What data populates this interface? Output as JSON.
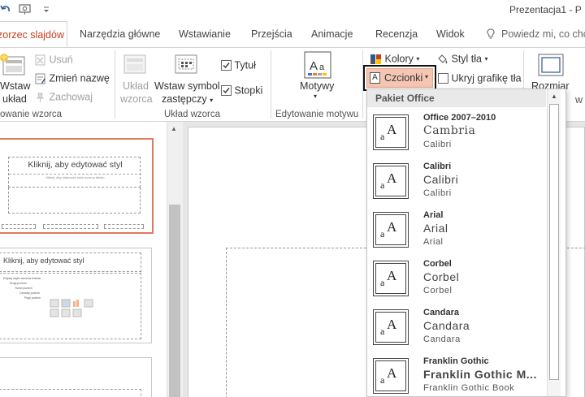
{
  "window": {
    "title": "Prezentacja1 - P"
  },
  "tabs": [
    {
      "label": "zorzec slajdów",
      "active": true
    },
    {
      "label": "Narzędzia główne"
    },
    {
      "label": "Wstawianie"
    },
    {
      "label": "Przejścia"
    },
    {
      "label": "Animacje"
    },
    {
      "label": "Recenzja"
    },
    {
      "label": "Widok"
    }
  ],
  "tell_me": {
    "placeholder": "Powiedz mi, co chc"
  },
  "ribbon": {
    "edit_master": {
      "insert_layout": [
        "Wstaw",
        "układ"
      ],
      "delete": "Usuń",
      "rename": "Zmień nazwę",
      "preserve": "Zachowaj",
      "group_label": "owanie wzorca"
    },
    "master_layout": {
      "layout": [
        "Układ",
        "wzorca"
      ],
      "insert_placeholder": [
        "Wstaw symbol",
        "zastępczy"
      ],
      "title_checkbox": "Tytuł",
      "footers_checkbox": "Stopki",
      "group_label": "Układ wzorca"
    },
    "edit_theme": {
      "themes": "Motywy",
      "group_label": "Edytowanie motywu"
    },
    "background": {
      "colors": "Kolory",
      "fonts": "Czcionki",
      "background_styles": "Styl tła",
      "hide_graphics": "Ukryj grafikę tła",
      "slide_size": "Rozmiar"
    }
  },
  "thumbnails": {
    "master_title": "Kliknij, aby edytować styl",
    "master_subtitle": "Kliknij, aby edytować style wzorca tekstu",
    "layout_title": "Kliknij, aby edytować styl",
    "layout_bullets": [
      "Edytuj style wzorca tekstu",
      "Drugi poziom",
      "Trzeci poziom",
      "Czwarty poziom",
      "Piąty poziom"
    ]
  },
  "fonts_dropdown": {
    "header": "Pakiet Office",
    "items": [
      {
        "name": "Office 2007–2010",
        "heading": "Cambria",
        "body": "Calibri"
      },
      {
        "name": "Calibri",
        "heading": "Calibri",
        "body": "Calibri"
      },
      {
        "name": "Arial",
        "heading": "Arial",
        "body": "Arial"
      },
      {
        "name": "Corbel",
        "heading": "Corbel",
        "body": "Corbel"
      },
      {
        "name": "Candara",
        "heading": "Candara",
        "body": "Candara"
      },
      {
        "name": "Franklin Gothic",
        "heading": "Franklin Gothic M...",
        "body": "Franklin Gothic Book"
      }
    ],
    "thumb_label": {
      "big": "A",
      "small": "a"
    }
  },
  "colors": {
    "accent": "#c43e1c",
    "thumb_border": "#e07a5f",
    "fonts_button_bg": "#f5c6b3"
  }
}
